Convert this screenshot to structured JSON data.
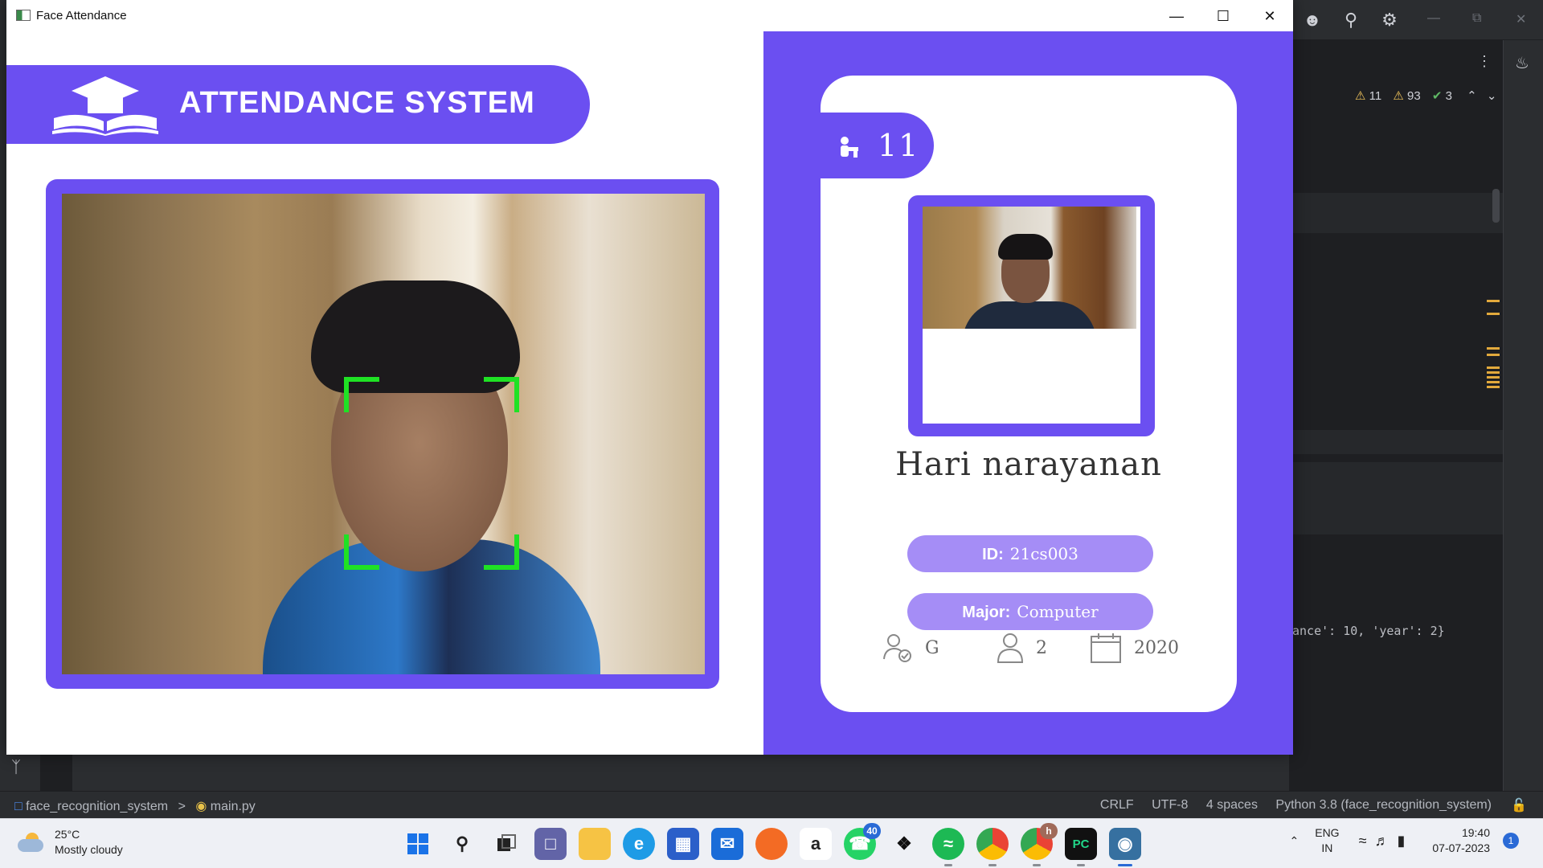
{
  "window": {
    "title": "Face Attendance",
    "minimize": "—",
    "maximize": "☐",
    "close": "✕"
  },
  "app": {
    "header_title": "ATTENDANCE SYSTEM",
    "total_attendance": "11",
    "student": {
      "name": "Hari narayanan",
      "id_label": "ID:",
      "id_value": "21cs003",
      "major_label": "Major:",
      "major_value": "Computer",
      "standing": "G",
      "year": "2",
      "starting_year": "2020"
    },
    "accent_color": "#6b4ff1",
    "pill_color": "#a58df6",
    "detection_box_color": "#1fe224"
  },
  "ide": {
    "inspections": {
      "warnings_a": "11",
      "warnings_b": "93",
      "ok": "3"
    },
    "code_snippet": "ance': 10, 'year': 2}",
    "status": {
      "project": "face_recognition_system",
      "separator": ">",
      "file": "main.py",
      "line_sep": "CRLF",
      "encoding": "UTF-8",
      "indent": "4 spaces",
      "interpreter": "Python 3.8 (face_recognition_system)"
    }
  },
  "taskbar": {
    "weather_temp": "25°C",
    "weather_desc": "Mostly cloudy",
    "whatsapp_badge": "40",
    "chrome_badge": "h",
    "lang_top": "ENG",
    "lang_bottom": "IN",
    "time": "19:40",
    "date": "07-07-2023",
    "notifications": "1"
  }
}
